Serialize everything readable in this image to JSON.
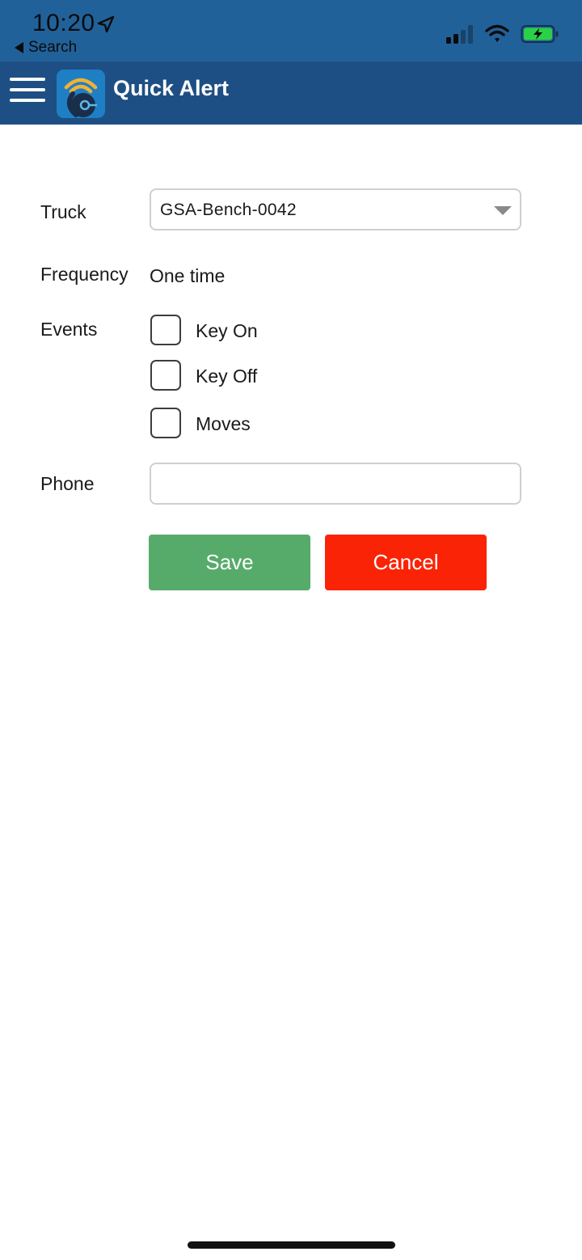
{
  "status_bar": {
    "time": "10:20",
    "back_label": "Search",
    "location_icon": "location-arrow-icon",
    "signal_icon": "cellular-signal-icon",
    "wifi_icon": "wifi-icon",
    "battery_icon": "battery-charging-icon",
    "battery_color": "#2bd049"
  },
  "header": {
    "title": "Quick Alert",
    "menu_icon": "hamburger-menu-icon",
    "logo_icon": "app-logo-icon",
    "bg_color": "#1e4f84"
  },
  "form": {
    "truck": {
      "label": "Truck",
      "selected": "GSA-Bench-0042"
    },
    "frequency": {
      "label": "Frequency",
      "value": "One time"
    },
    "events": {
      "label": "Events",
      "options": [
        {
          "label": "Key On",
          "checked": false
        },
        {
          "label": "Key Off",
          "checked": false
        },
        {
          "label": "Moves",
          "checked": false
        }
      ]
    },
    "phone": {
      "label": "Phone",
      "value": "",
      "placeholder": ""
    }
  },
  "actions": {
    "save_label": "Save",
    "cancel_label": "Cancel",
    "save_color": "#57ab6a",
    "cancel_color": "#fa2306"
  }
}
